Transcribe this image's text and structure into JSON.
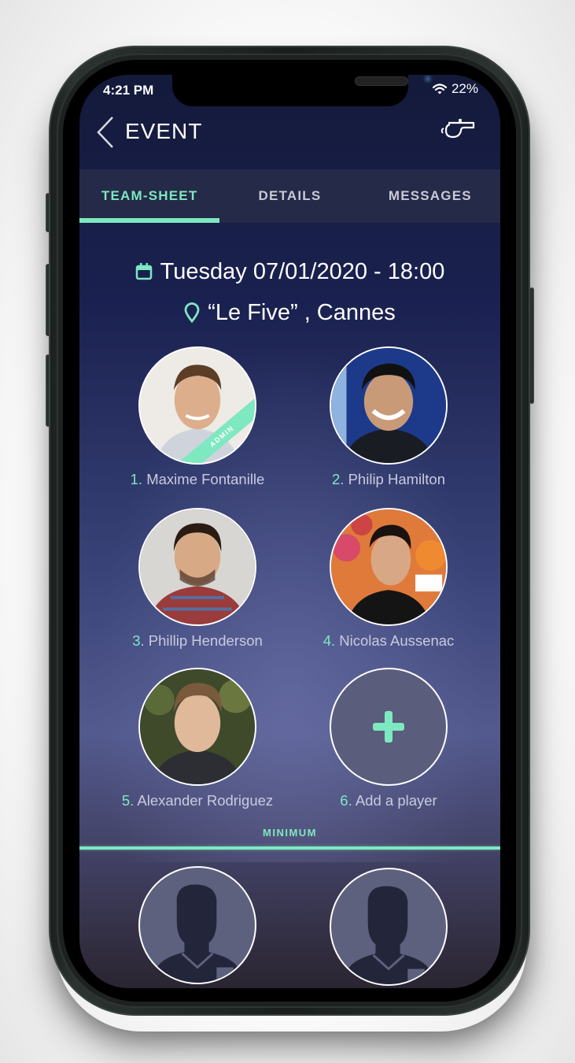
{
  "status_bar": {
    "time": "4:21 PM",
    "battery": "22%",
    "wifi_icon": "wifi-icon"
  },
  "header": {
    "title": "EVENT",
    "back_icon": "chevron-left-icon",
    "action_icon": "whistle-icon"
  },
  "tabs": [
    {
      "label": "TEAM-SHEET",
      "active": true
    },
    {
      "label": "DETAILS",
      "active": false
    },
    {
      "label": "MESSAGES",
      "active": false
    }
  ],
  "event": {
    "datetime": "Tuesday 07/01/2020 - 18:00",
    "location": "“Le Five” , Cannes",
    "calendar_icon": "calendar-icon",
    "location_icon": "map-pin-icon"
  },
  "players": [
    {
      "number": "1.",
      "name": "Maxime Fontanille",
      "badge": "ADMIN"
    },
    {
      "number": "2.",
      "name": "Philip Hamilton"
    },
    {
      "number": "3.",
      "name": "Phillip Henderson"
    },
    {
      "number": "4.",
      "name": "Nicolas Aussenac"
    },
    {
      "number": "5.",
      "name": "Alexander Rodriguez"
    },
    {
      "number": "6.",
      "name": "Add a player",
      "is_add": true
    }
  ],
  "minimum": {
    "label": "MINIMUM"
  },
  "colors": {
    "accent": "#7ee8c0",
    "tab_bar": "#242a48",
    "background_top": "#141a3a"
  }
}
